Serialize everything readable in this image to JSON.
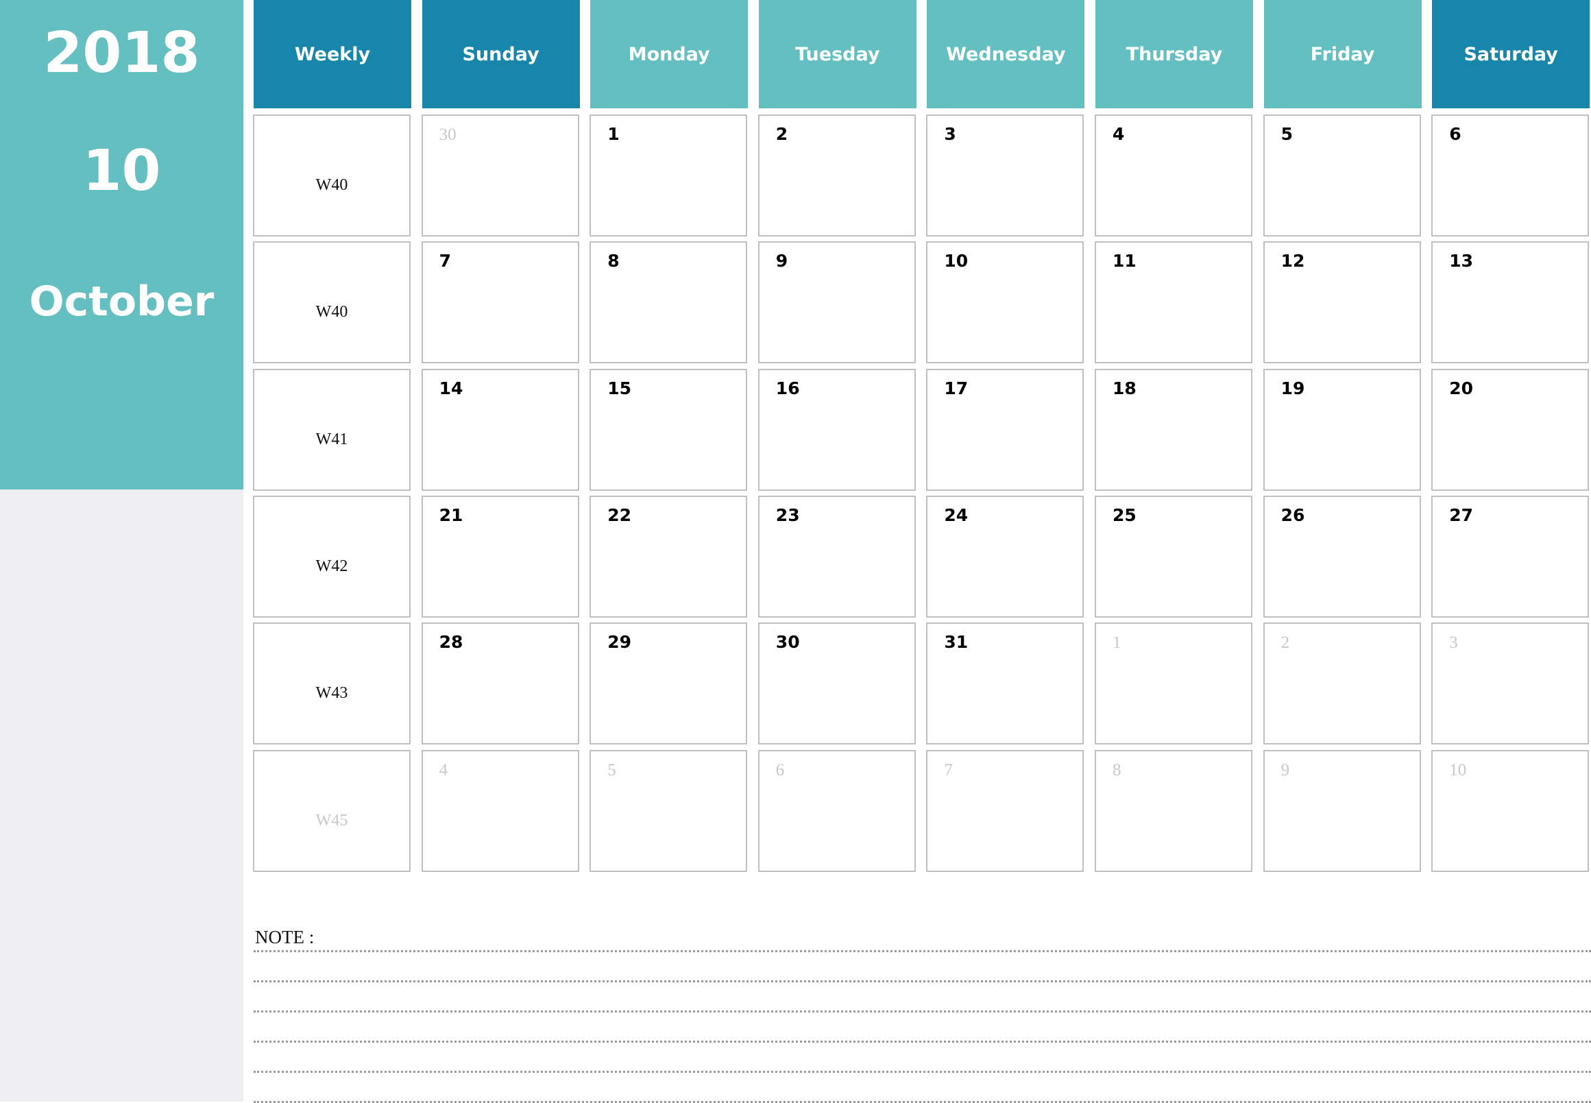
{
  "sidebar": {
    "year": "2018",
    "month_number": "10",
    "month_name": "October"
  },
  "colors": {
    "teal": "#64bfc0",
    "dark_blue": "#1886aa",
    "side_gray": "#efeef3",
    "cell_border": "#c0c0c0",
    "muted_text": "#c8c8c8"
  },
  "headers": [
    {
      "label": "Weekly",
      "style": "dark"
    },
    {
      "label": "Sunday",
      "style": "dark"
    },
    {
      "label": "Monday",
      "style": "light"
    },
    {
      "label": "Tuesday",
      "style": "light"
    },
    {
      "label": "Wednesday",
      "style": "light"
    },
    {
      "label": "Thursday",
      "style": "light"
    },
    {
      "label": "Friday",
      "style": "light"
    },
    {
      "label": "Saturday",
      "style": "dark"
    }
  ],
  "weeks": [
    {
      "week": "W40",
      "week_muted": false,
      "days": [
        {
          "d": "30",
          "muted": true
        },
        {
          "d": "1",
          "muted": false
        },
        {
          "d": "2",
          "muted": false
        },
        {
          "d": "3",
          "muted": false
        },
        {
          "d": "4",
          "muted": false
        },
        {
          "d": "5",
          "muted": false
        },
        {
          "d": "6",
          "muted": false
        }
      ]
    },
    {
      "week": "W40",
      "week_muted": false,
      "days": [
        {
          "d": "7",
          "muted": false
        },
        {
          "d": "8",
          "muted": false
        },
        {
          "d": "9",
          "muted": false
        },
        {
          "d": "10",
          "muted": false
        },
        {
          "d": "11",
          "muted": false
        },
        {
          "d": "12",
          "muted": false
        },
        {
          "d": "13",
          "muted": false
        }
      ]
    },
    {
      "week": "W41",
      "week_muted": false,
      "days": [
        {
          "d": "14",
          "muted": false
        },
        {
          "d": "15",
          "muted": false
        },
        {
          "d": "16",
          "muted": false
        },
        {
          "d": "17",
          "muted": false
        },
        {
          "d": "18",
          "muted": false
        },
        {
          "d": "19",
          "muted": false
        },
        {
          "d": "20",
          "muted": false
        }
      ]
    },
    {
      "week": "W42",
      "week_muted": false,
      "days": [
        {
          "d": "21",
          "muted": false
        },
        {
          "d": "22",
          "muted": false
        },
        {
          "d": "23",
          "muted": false
        },
        {
          "d": "24",
          "muted": false
        },
        {
          "d": "25",
          "muted": false
        },
        {
          "d": "26",
          "muted": false
        },
        {
          "d": "27",
          "muted": false
        }
      ]
    },
    {
      "week": "W43",
      "week_muted": false,
      "days": [
        {
          "d": "28",
          "muted": false
        },
        {
          "d": "29",
          "muted": false
        },
        {
          "d": "30",
          "muted": false
        },
        {
          "d": "31",
          "muted": false
        },
        {
          "d": "1",
          "muted": true
        },
        {
          "d": "2",
          "muted": true
        },
        {
          "d": "3",
          "muted": true
        }
      ]
    },
    {
      "week": "W45",
      "week_muted": true,
      "days": [
        {
          "d": "4",
          "muted": true
        },
        {
          "d": "5",
          "muted": true
        },
        {
          "d": "6",
          "muted": true
        },
        {
          "d": "7",
          "muted": true
        },
        {
          "d": "8",
          "muted": true
        },
        {
          "d": "9",
          "muted": true
        },
        {
          "d": "10",
          "muted": true
        }
      ]
    }
  ],
  "notes": {
    "label": "NOTE :",
    "line_count": 6
  }
}
